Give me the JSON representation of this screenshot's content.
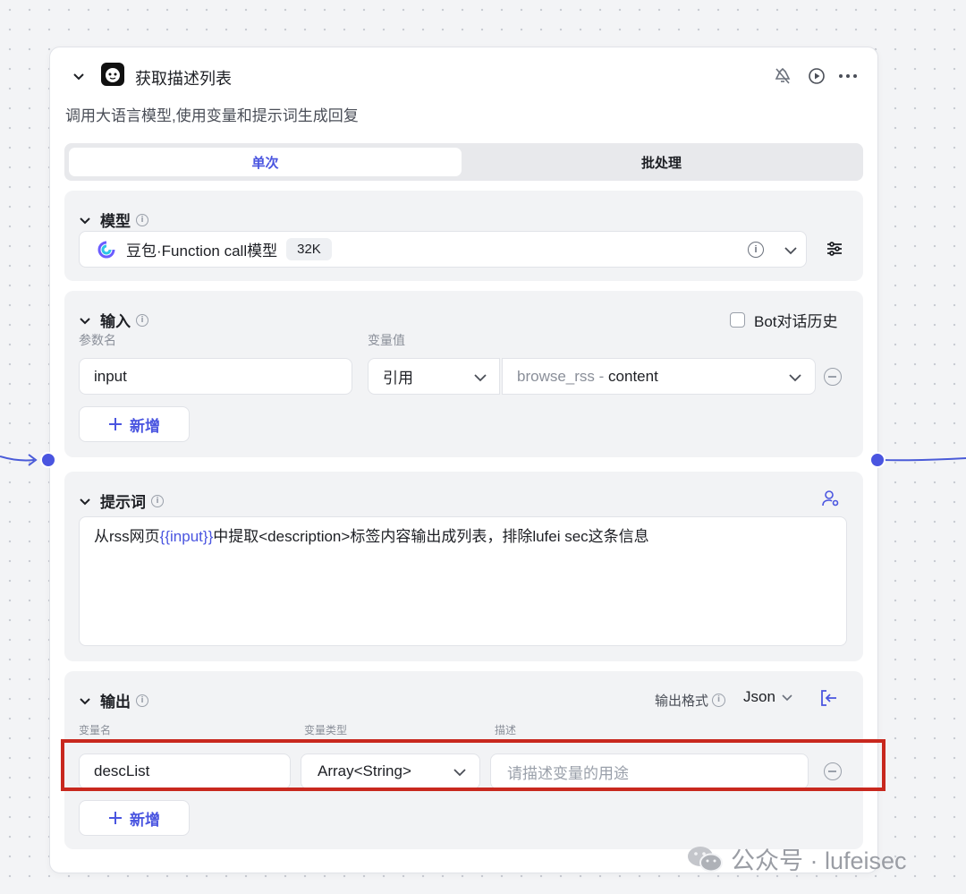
{
  "node": {
    "title": "获取描述列表",
    "description": "调用大语言模型,使用变量和提示词生成回复",
    "tabs": [
      {
        "label": "单次",
        "active": true
      },
      {
        "label": "批处理",
        "active": false
      }
    ]
  },
  "model": {
    "section_label": "模型",
    "name": "豆包·Function call模型",
    "badge": "32K"
  },
  "input": {
    "section_label": "输入",
    "history_label": "Bot对话历史",
    "history_checked": false,
    "param_name_header": "参数名",
    "var_value_header": "变量值",
    "rows": [
      {
        "name": "input",
        "source_type": "引用",
        "ref_node": "browse_rss",
        "ref_separator": " - ",
        "ref_field": "content"
      }
    ],
    "add_label": "新增"
  },
  "prompt": {
    "section_label": "提示词",
    "text_before": "从rss网页",
    "variable": "{{input}}",
    "text_after": "中提取<description>标签内容输出成列表，排除lufei sec这条信息"
  },
  "output": {
    "section_label": "输出",
    "format_label": "输出格式",
    "format_value": "Json",
    "var_name_header": "变量名",
    "var_type_header": "变量类型",
    "desc_header": "描述",
    "rows": [
      {
        "name": "descList",
        "type": "Array<String>",
        "desc_placeholder": "请描述变量的用途"
      }
    ],
    "add_label": "新增"
  },
  "watermark": {
    "text": "公众号 · lufeisec"
  },
  "colors": {
    "accent": "#4a55e0",
    "highlight_border": "#c8281e",
    "connector": "#4a5bd8"
  }
}
